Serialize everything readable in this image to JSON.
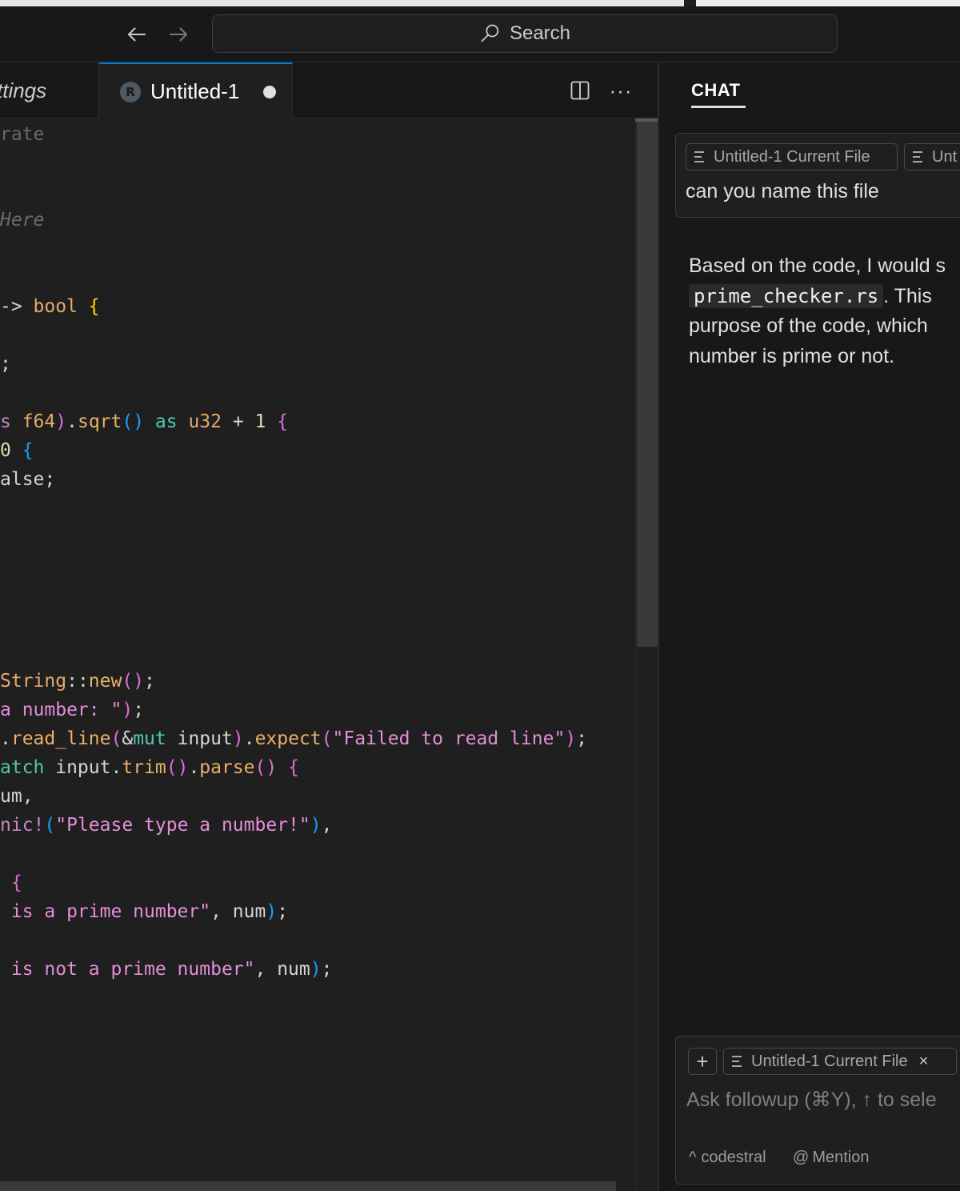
{
  "titlebar": {
    "search_label": "Search",
    "icons": {
      "back": "arrow-left-icon",
      "forward": "arrow-right-icon",
      "search": "search-icon"
    }
  },
  "tabs": [
    {
      "label": "ttings",
      "active": false
    },
    {
      "label": "Untitled-1",
      "active": true,
      "icon": "rust-file-icon",
      "dirty": true
    }
  ],
  "editor_actions": {
    "split": "split-editor-icon",
    "more": "···"
  },
  "code_lines": [
    {
      "segments": [
        {
          "t": "rate",
          "c": "c-dim"
        }
      ]
    },
    {
      "segments": [
        {
          "t": "Here",
          "c": "c-comment"
        }
      ]
    },
    {
      "segments": [
        {
          "t": "-> ",
          "c": "c-plain"
        },
        {
          "t": "bool ",
          "c": "c-orange"
        },
        {
          "t": "{",
          "c": "c-bracket-y"
        }
      ]
    },
    {
      "segments": [
        {
          "t": ";",
          "c": "c-plain"
        }
      ]
    },
    {
      "segments": [
        {
          "t": "s ",
          "c": "c-kw"
        },
        {
          "t": "f64",
          "c": "c-orange"
        },
        {
          "t": ")",
          "c": "c-bracket-p"
        },
        {
          "t": ".",
          "c": "c-plain"
        },
        {
          "t": "sqrt",
          "c": "c-fn"
        },
        {
          "t": "()",
          "c": "c-bracket-b"
        },
        {
          "t": " as ",
          "c": "c-teal"
        },
        {
          "t": "u32",
          "c": "c-orange"
        },
        {
          "t": " + ",
          "c": "c-plain"
        },
        {
          "t": "1",
          "c": "c-yellow"
        },
        {
          "t": " {",
          "c": "c-bracket-p"
        }
      ]
    },
    {
      "segments": [
        {
          "t": "0",
          "c": "c-yellow"
        },
        {
          "t": " {",
          "c": "c-bracket-b"
        }
      ]
    },
    {
      "segments": [
        {
          "t": "alse",
          "c": "c-plain"
        },
        {
          "t": ";",
          "c": "c-plain"
        }
      ]
    },
    {
      "segments": [
        {
          "t": "String",
          "c": "c-orange"
        },
        {
          "t": "::",
          "c": "c-plain"
        },
        {
          "t": "new",
          "c": "c-fn"
        },
        {
          "t": "()",
          "c": "c-bracket-p"
        },
        {
          "t": ";",
          "c": "c-plain"
        }
      ]
    },
    {
      "segments": [
        {
          "t": "a number: \"",
          "c": "c-str"
        },
        {
          "t": ")",
          "c": "c-bracket-p"
        },
        {
          "t": ";",
          "c": "c-plain"
        }
      ]
    },
    {
      "segments": [
        {
          "t": ".",
          "c": "c-plain"
        },
        {
          "t": "read_line",
          "c": "c-fn"
        },
        {
          "t": "(",
          "c": "c-bracket-p"
        },
        {
          "t": "&",
          "c": "c-plain"
        },
        {
          "t": "mut",
          "c": "c-teal"
        },
        {
          "t": " input",
          "c": "c-plain"
        },
        {
          "t": ")",
          "c": "c-bracket-p"
        },
        {
          "t": ".",
          "c": "c-plain"
        },
        {
          "t": "expect",
          "c": "c-fn"
        },
        {
          "t": "(",
          "c": "c-bracket-p"
        },
        {
          "t": "\"Failed to read line\"",
          "c": "c-str"
        },
        {
          "t": ")",
          "c": "c-bracket-p"
        },
        {
          "t": ";",
          "c": "c-plain"
        }
      ]
    },
    {
      "segments": [
        {
          "t": "atch",
          "c": "c-teal"
        },
        {
          "t": " input",
          "c": "c-plain"
        },
        {
          "t": ".",
          "c": "c-plain"
        },
        {
          "t": "trim",
          "c": "c-fn"
        },
        {
          "t": "()",
          "c": "c-bracket-p"
        },
        {
          "t": ".",
          "c": "c-plain"
        },
        {
          "t": "parse",
          "c": "c-fn"
        },
        {
          "t": "()",
          "c": "c-bracket-p"
        },
        {
          "t": " {",
          "c": "c-bracket-p"
        }
      ]
    },
    {
      "segments": [
        {
          "t": "um",
          "c": "c-plain"
        },
        {
          "t": ",",
          "c": "c-plain"
        }
      ]
    },
    {
      "segments": [
        {
          "t": "nic!",
          "c": "c-kw"
        },
        {
          "t": "(",
          "c": "c-bracket-b"
        },
        {
          "t": "\"Please type a number!\"",
          "c": "c-str"
        },
        {
          "t": ")",
          "c": "c-bracket-b"
        },
        {
          "t": ",",
          "c": "c-plain"
        }
      ]
    },
    {
      "segments": [
        {
          "t": " {",
          "c": "c-bracket-p"
        }
      ]
    },
    {
      "segments": [
        {
          "t": " is a prime number\"",
          "c": "c-str"
        },
        {
          "t": ", num",
          "c": "c-plain"
        },
        {
          "t": ")",
          "c": "c-bracket-b"
        },
        {
          "t": ";",
          "c": "c-plain"
        }
      ]
    },
    {
      "segments": [
        {
          "t": " is not a prime number\"",
          "c": "c-str"
        },
        {
          "t": ", num",
          "c": "c-plain"
        },
        {
          "t": ")",
          "c": "c-bracket-b"
        },
        {
          "t": ";",
          "c": "c-plain"
        }
      ]
    }
  ],
  "chat": {
    "title": "CHAT",
    "message": {
      "chips": [
        "Untitled-1 Current File",
        "Unt"
      ],
      "text": "can you name this file"
    },
    "reply": {
      "line1": "Based on the code, I would s",
      "code": "prime_checker.rs",
      "line2_after": ". This",
      "line3": "purpose of the code, which",
      "line4": "number is prime or not."
    },
    "input": {
      "plus": "+",
      "chip": "Untitled-1 Current File",
      "chip_close": "×",
      "placeholder": "Ask followup (⌘Y), ↑ to sele",
      "model_caret": "^",
      "model": "codestral",
      "mention_at": "@",
      "mention": "Mention"
    }
  }
}
